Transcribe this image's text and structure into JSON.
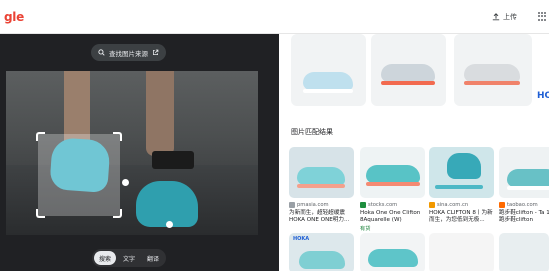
{
  "app": {
    "logo_text": "gle",
    "upload_label": "上传"
  },
  "left": {
    "find_source_label": "查找图片来源",
    "modes": [
      {
        "label": "搜索",
        "active": true
      },
      {
        "label": "文字",
        "active": false
      },
      {
        "label": "翻译",
        "active": false
      }
    ]
  },
  "right": {
    "partial_brand": "HO",
    "section_title": "图片匹配结果",
    "cards": [
      {
        "source": "pmasia.com",
        "title": "为新而生，超轻超缓震 HOKA ONE ONE明力...",
        "stock": ""
      },
      {
        "source": "stocks.com",
        "title": "Hoka One One Clifton 8Aquarelle (W)",
        "stock": "有货"
      },
      {
        "source": "sina.com.cn",
        "title": "HOKA CLIFTON 8丨为新而生，为您低到无极...",
        "stock": ""
      },
      {
        "source": "taobao.com",
        "title": "跑步鞋clifton - Ta 100件跑步鞋clifton",
        "stock": ""
      }
    ],
    "bottom_brand": "HOKA"
  },
  "colors": {
    "dark_bg": "#202124",
    "accent_blue": "#1a73e8",
    "teal_shoe": "#3ab0c4"
  }
}
